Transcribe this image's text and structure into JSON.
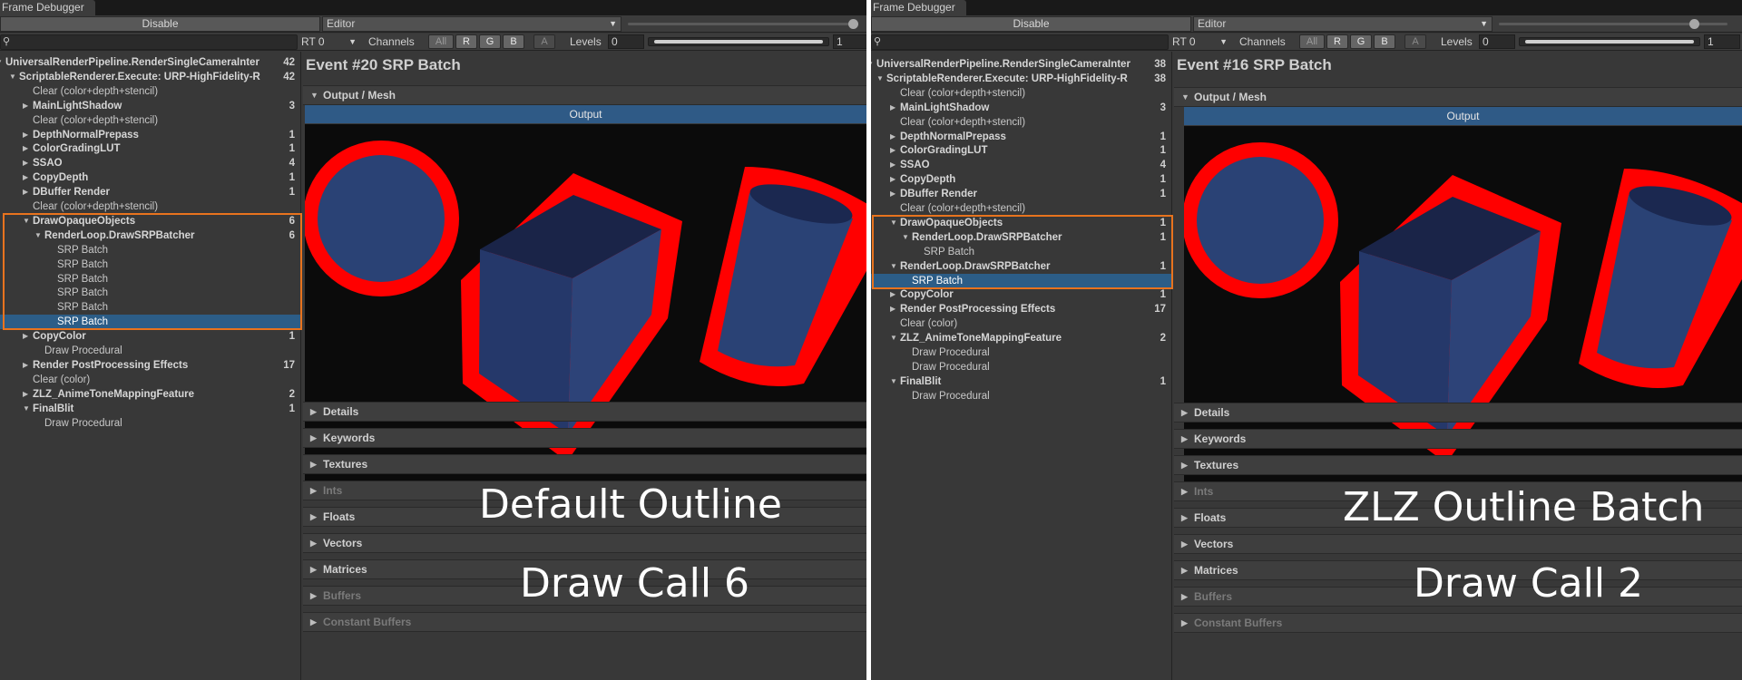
{
  "left": {
    "window_title": "Frame Debugger",
    "disable_label": "Disable",
    "editor_label": "Editor",
    "rt_label": "RT 0",
    "channels_label": "Channels",
    "channel_all": "All",
    "channel_r": "R",
    "channel_g": "G",
    "channel_b": "B",
    "channel_a": "A",
    "levels_label": "Levels",
    "levels_min": "0",
    "levels_max": "1",
    "event_title": "Event #20 SRP Batch",
    "output_mesh_label": "Output / Mesh",
    "output_label": "Output",
    "overlay_title": "Default Outline",
    "overlay_drawcall": "Draw Call 6",
    "tree": [
      {
        "label": "UniversalRenderPipeline.RenderSingleCameraInter",
        "count": "42",
        "bold": true
      },
      {
        "label": "ScriptableRenderer.Execute: URP-HighFidelity-R",
        "count": "42",
        "bold": true
      },
      {
        "label": "Clear (color+depth+stencil)",
        "count": "",
        "bold": false
      },
      {
        "label": "MainLightShadow",
        "count": "3",
        "bold": true
      },
      {
        "label": "Clear (color+depth+stencil)",
        "count": "",
        "bold": false
      },
      {
        "label": "DepthNormalPrepass",
        "count": "1",
        "bold": true
      },
      {
        "label": "ColorGradingLUT",
        "count": "1",
        "bold": true
      },
      {
        "label": "SSAO",
        "count": "4",
        "bold": true
      },
      {
        "label": "CopyDepth",
        "count": "1",
        "bold": true
      },
      {
        "label": "DBuffer Render",
        "count": "1",
        "bold": true
      },
      {
        "label": "Clear (color+depth+stencil)",
        "count": "",
        "bold": false
      },
      {
        "label": "DrawOpaqueObjects",
        "count": "6",
        "bold": true
      },
      {
        "label": "RenderLoop.DrawSRPBatcher",
        "count": "6",
        "bold": true
      },
      {
        "label": "SRP Batch",
        "count": "",
        "bold": false
      },
      {
        "label": "SRP Batch",
        "count": "",
        "bold": false
      },
      {
        "label": "SRP Batch",
        "count": "",
        "bold": false
      },
      {
        "label": "SRP Batch",
        "count": "",
        "bold": false
      },
      {
        "label": "SRP Batch",
        "count": "",
        "bold": false
      },
      {
        "label": "SRP Batch",
        "count": "",
        "bold": false
      },
      {
        "label": "CopyColor",
        "count": "1",
        "bold": true
      },
      {
        "label": "Draw Procedural",
        "count": "",
        "bold": false
      },
      {
        "label": "Render PostProcessing Effects",
        "count": "17",
        "bold": true
      },
      {
        "label": "Clear (color)",
        "count": "",
        "bold": false
      },
      {
        "label": "ZLZ_AnimeToneMappingFeature",
        "count": "2",
        "bold": true
      },
      {
        "label": "FinalBlit",
        "count": "1",
        "bold": true
      },
      {
        "label": "Draw Procedural",
        "count": "",
        "bold": false
      }
    ],
    "sections": [
      "Details",
      "Keywords",
      "Textures",
      "Ints",
      "Floats",
      "Vectors",
      "Matrices",
      "Buffers",
      "Constant Buffers"
    ]
  },
  "right": {
    "window_title": "Frame Debugger",
    "disable_label": "Disable",
    "editor_label": "Editor",
    "rt_label": "RT 0",
    "channels_label": "Channels",
    "channel_all": "All",
    "channel_r": "R",
    "channel_g": "G",
    "channel_b": "B",
    "channel_a": "A",
    "levels_label": "Levels",
    "levels_min": "0",
    "levels_max": "1",
    "event_title": "Event #16 SRP Batch",
    "output_mesh_label": "Output / Mesh",
    "output_label": "Output",
    "overlay_title": "ZLZ Outline Batch",
    "overlay_drawcall": "Draw Call 2",
    "tree": [
      {
        "label": "UniversalRenderPipeline.RenderSingleCameraInter",
        "count": "38",
        "bold": true
      },
      {
        "label": "ScriptableRenderer.Execute: URP-HighFidelity-R",
        "count": "38",
        "bold": true
      },
      {
        "label": "Clear (color+depth+stencil)",
        "count": "",
        "bold": false
      },
      {
        "label": "MainLightShadow",
        "count": "3",
        "bold": true
      },
      {
        "label": "Clear (color+depth+stencil)",
        "count": "",
        "bold": false
      },
      {
        "label": "DepthNormalPrepass",
        "count": "1",
        "bold": true
      },
      {
        "label": "ColorGradingLUT",
        "count": "1",
        "bold": true
      },
      {
        "label": "SSAO",
        "count": "4",
        "bold": true
      },
      {
        "label": "CopyDepth",
        "count": "1",
        "bold": true
      },
      {
        "label": "DBuffer Render",
        "count": "1",
        "bold": true
      },
      {
        "label": "Clear (color+depth+stencil)",
        "count": "",
        "bold": false
      },
      {
        "label": "DrawOpaqueObjects",
        "count": "1",
        "bold": true
      },
      {
        "label": "RenderLoop.DrawSRPBatcher",
        "count": "1",
        "bold": true
      },
      {
        "label": "SRP Batch",
        "count": "",
        "bold": false
      },
      {
        "label": "RenderLoop.DrawSRPBatcher",
        "count": "1",
        "bold": true
      },
      {
        "label": "SRP Batch",
        "count": "",
        "bold": false
      },
      {
        "label": "CopyColor",
        "count": "1",
        "bold": true
      },
      {
        "label": "Render PostProcessing Effects",
        "count": "17",
        "bold": true
      },
      {
        "label": "Clear (color)",
        "count": "",
        "bold": false
      },
      {
        "label": "ZLZ_AnimeToneMappingFeature",
        "count": "2",
        "bold": true
      },
      {
        "label": "Draw Procedural",
        "count": "",
        "bold": false
      },
      {
        "label": "Draw Procedural",
        "count": "",
        "bold": false
      },
      {
        "label": "FinalBlit",
        "count": "1",
        "bold": true
      },
      {
        "label": "Draw Procedural",
        "count": "",
        "bold": false
      }
    ],
    "sections": [
      "Details",
      "Keywords",
      "Textures",
      "Ints",
      "Floats",
      "Vectors",
      "Matrices",
      "Buffers",
      "Constant Buffers"
    ]
  }
}
